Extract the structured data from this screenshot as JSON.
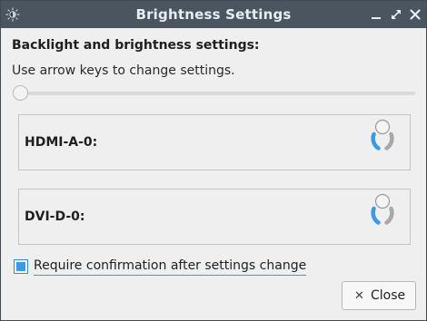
{
  "window": {
    "title": "Brightness Settings",
    "icons": {
      "app": "brightness-icon",
      "minimize": "minimize-icon",
      "maximize": "maximize-icon",
      "close": "close-icon"
    }
  },
  "content": {
    "heading": "Backlight and brightness settings:",
    "hint": "Use arrow keys to change settings.",
    "backlight_slider": {
      "level": 0
    }
  },
  "monitors": [
    {
      "label": "HDMI-A-0:",
      "icon": "brightness-dial-icon",
      "accent": "#3a9be3"
    },
    {
      "label": "DVI-D-0:",
      "icon": "brightness-dial-icon",
      "accent": "#3a9be3"
    }
  ],
  "confirm": {
    "label": "Require confirmation after settings change",
    "checked": true
  },
  "footer": {
    "close_label": "Close",
    "close_icon": "close-x-icon"
  },
  "colors": {
    "titlebar": "#4a5560",
    "accent": "#3a9be3",
    "background": "#efefef"
  }
}
